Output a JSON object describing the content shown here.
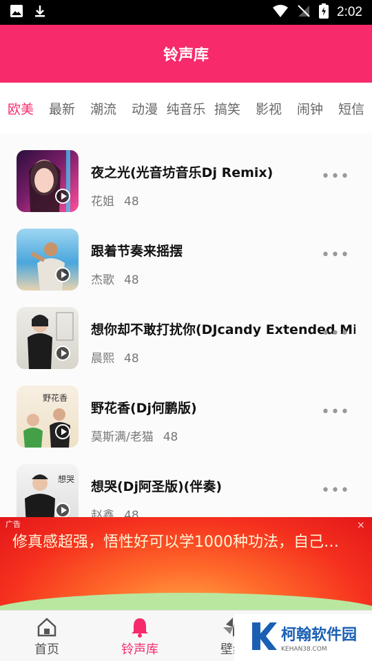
{
  "status": {
    "time": "2:02"
  },
  "header": {
    "title": "铃声库"
  },
  "tabs": [
    "欧美",
    "最新",
    "潮流",
    "动漫",
    "纯音乐",
    "搞笑",
    "影视",
    "闹钟",
    "短信"
  ],
  "songs": [
    {
      "title": "夜之光(光音坊音乐Dj Remix)",
      "artist": "花姐",
      "count": "48",
      "cover": [
        "#7a1d6a",
        "#ff4f9a"
      ]
    },
    {
      "title": "跟着节奏来摇摆",
      "artist": "杰歌",
      "count": "48",
      "cover": [
        "#2b8fd6",
        "#c9a27a"
      ]
    },
    {
      "title": "想你却不敢打扰你(DJcandy Extended Mix)",
      "artist": "晨熙",
      "count": "48",
      "cover": [
        "#e8e6e0",
        "#2d2d2d"
      ]
    },
    {
      "title": "野花香(Dj何鹏版)",
      "artist": "莫斯满/老猫",
      "count": "48",
      "cover": [
        "#f2e8d6",
        "#d9534f"
      ]
    },
    {
      "title": "想哭(Dj阿圣版)(伴奏)",
      "artist": "赵鑫",
      "count": "48",
      "cover": [
        "#efefef",
        "#1d1d1d"
      ]
    }
  ],
  "ad": {
    "tag": "广告",
    "text": "修真感超强，悟性好可以学1000种功法，自己…",
    "close": "×"
  },
  "nav": [
    {
      "label": "首页"
    },
    {
      "label": "铃声库"
    },
    {
      "label": "壁纸"
    }
  ],
  "watermark": {
    "name": "柯翰软件园",
    "url": "KEHAN38.COM"
  },
  "colors": {
    "accent": "#f72a6b"
  }
}
